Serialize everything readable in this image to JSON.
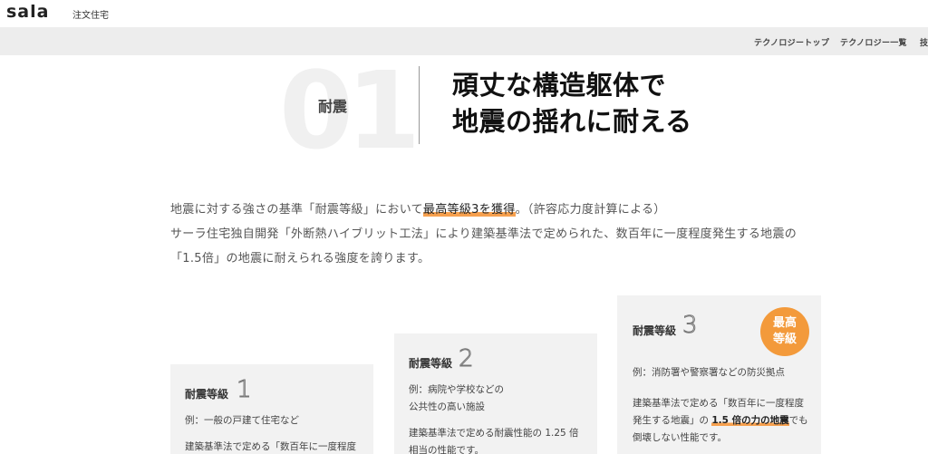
{
  "header": {
    "logo": "sala",
    "logo_sub": "注文住宅",
    "nav": [
      "テクノロジートップ",
      "テクノロジー一覧",
      "技"
    ]
  },
  "section": {
    "number": "01",
    "category": "耐震",
    "headline": [
      "頑丈な構造躯体で",
      "地震の揺れに耐える"
    ]
  },
  "intro": {
    "line1_before": "地震に対する強さの基準「耐震等級」において",
    "line1_highlight": "最高等級3を獲得",
    "line1_after": "。（許容応力度計算による）",
    "line2": "サーラ住宅独自開発「外断熱ハイブリット工法」により建築基準法で定められた、数百年に一度程度発生する地震の",
    "line3": "「1.5倍」の地震に耐えられる強度を誇ります。"
  },
  "cards": [
    {
      "title": "耐震等級",
      "level": "1",
      "example": "例：一般の戸建て住宅など",
      "text": "建築基準法で定める「数百年に一度程度"
    },
    {
      "title": "耐震等級",
      "level": "2",
      "example1": "例：病院や学校などの",
      "example2": "公共性の高い施設",
      "text1": "建築基準法で定める耐震性能の 1.25 倍",
      "text2": "相当の性能です。"
    },
    {
      "title": "耐震等級",
      "level": "3",
      "badge": [
        "最高",
        "等級"
      ],
      "example": "例：消防署や警察署などの防災拠点",
      "text1": "建築基準法で定める「数百年に一度程度",
      "text2_before": "発生する地震」の ",
      "text2_highlight": "1.5 倍の力の地震",
      "text2_after": "でも",
      "text3": "倒壊しない性能です。"
    }
  ],
  "colors": {
    "accent": "#f39a3b",
    "underline": "#f6a04e",
    "nav_bg": "#ededed",
    "card_bg": "#f2f2f2"
  }
}
